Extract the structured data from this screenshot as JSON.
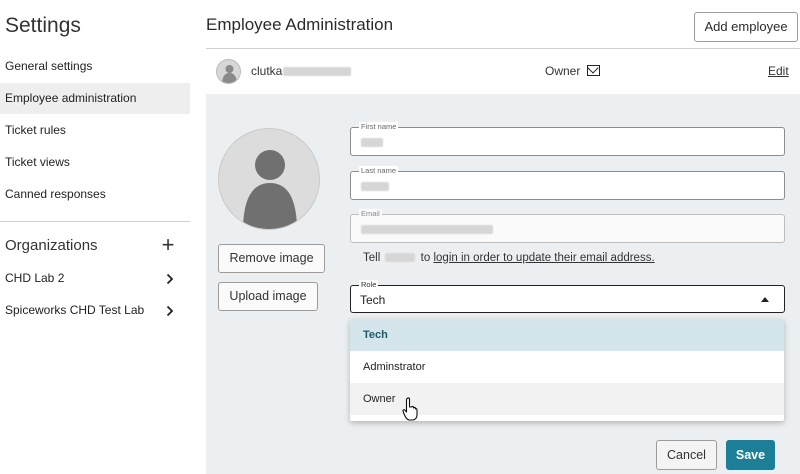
{
  "sidebar": {
    "title": "Settings",
    "items": [
      {
        "label": "General settings"
      },
      {
        "label": "Employee administration"
      },
      {
        "label": "Ticket rules"
      },
      {
        "label": "Ticket views"
      },
      {
        "label": "Canned responses"
      }
    ],
    "organizations_title": "Organizations",
    "add_org_symbol": "+",
    "organizations": [
      {
        "label": "CHD Lab 2"
      },
      {
        "label": "Spiceworks CHD Test Lab"
      }
    ]
  },
  "header": {
    "title": "Employee Administration",
    "add_button": "Add employee"
  },
  "employee": {
    "name_prefix": "clutka",
    "role": "Owner",
    "edit_link": "Edit"
  },
  "form": {
    "remove_image": "Remove image",
    "upload_image": "Upload image",
    "first_name_label": "First name",
    "last_name_label": "Last name",
    "email_label": "Email",
    "tell_prefix": "Tell",
    "tell_middle": "to",
    "tell_link": "login in order to update their email address.",
    "role_label": "Role",
    "role_value": "Tech",
    "role_options": [
      {
        "label": "Tech"
      },
      {
        "label": "Adminstrator"
      },
      {
        "label": "Owner"
      }
    ],
    "cancel": "Cancel",
    "save": "Save"
  },
  "colors": {
    "accent": "#1c7f97",
    "selected_option_bg": "#d4e6ec",
    "panel_bg": "#eceff1"
  },
  "icons": {
    "mail": "envelope-icon",
    "avatar": "person-silhouette",
    "chevron": "chevron-right-icon",
    "caret": "caret-up-icon",
    "cursor": "hand-pointer-cursor"
  }
}
